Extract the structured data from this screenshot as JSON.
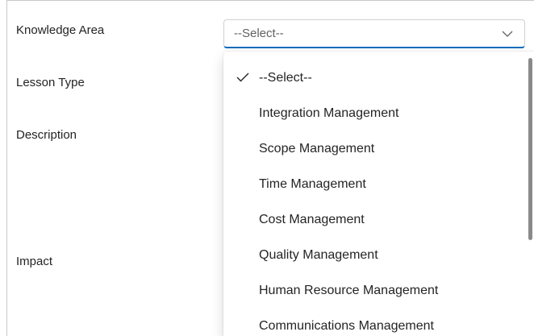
{
  "form": {
    "labels": {
      "knowledge_area": "Knowledge Area",
      "lesson_type": "Lesson Type",
      "description": "Description",
      "impact": "Impact"
    },
    "knowledge_area_select": {
      "value": "--Select--",
      "icon": "chevron-down-icon"
    }
  },
  "dropdown": {
    "selected_icon": "checkmark-icon",
    "options": [
      {
        "label": "--Select--",
        "selected": true
      },
      {
        "label": "Integration Management",
        "selected": false
      },
      {
        "label": "Scope Management",
        "selected": false
      },
      {
        "label": "Time Management",
        "selected": false
      },
      {
        "label": "Cost Management",
        "selected": false
      },
      {
        "label": "Quality Management",
        "selected": false
      },
      {
        "label": "Human Resource Management",
        "selected": false
      },
      {
        "label": "Communications Management",
        "selected": false
      }
    ]
  },
  "colors": {
    "accent": "#0f6cbd",
    "text": "#242424",
    "placeholder": "#616161",
    "scrollbar": "#8a8a8a"
  }
}
